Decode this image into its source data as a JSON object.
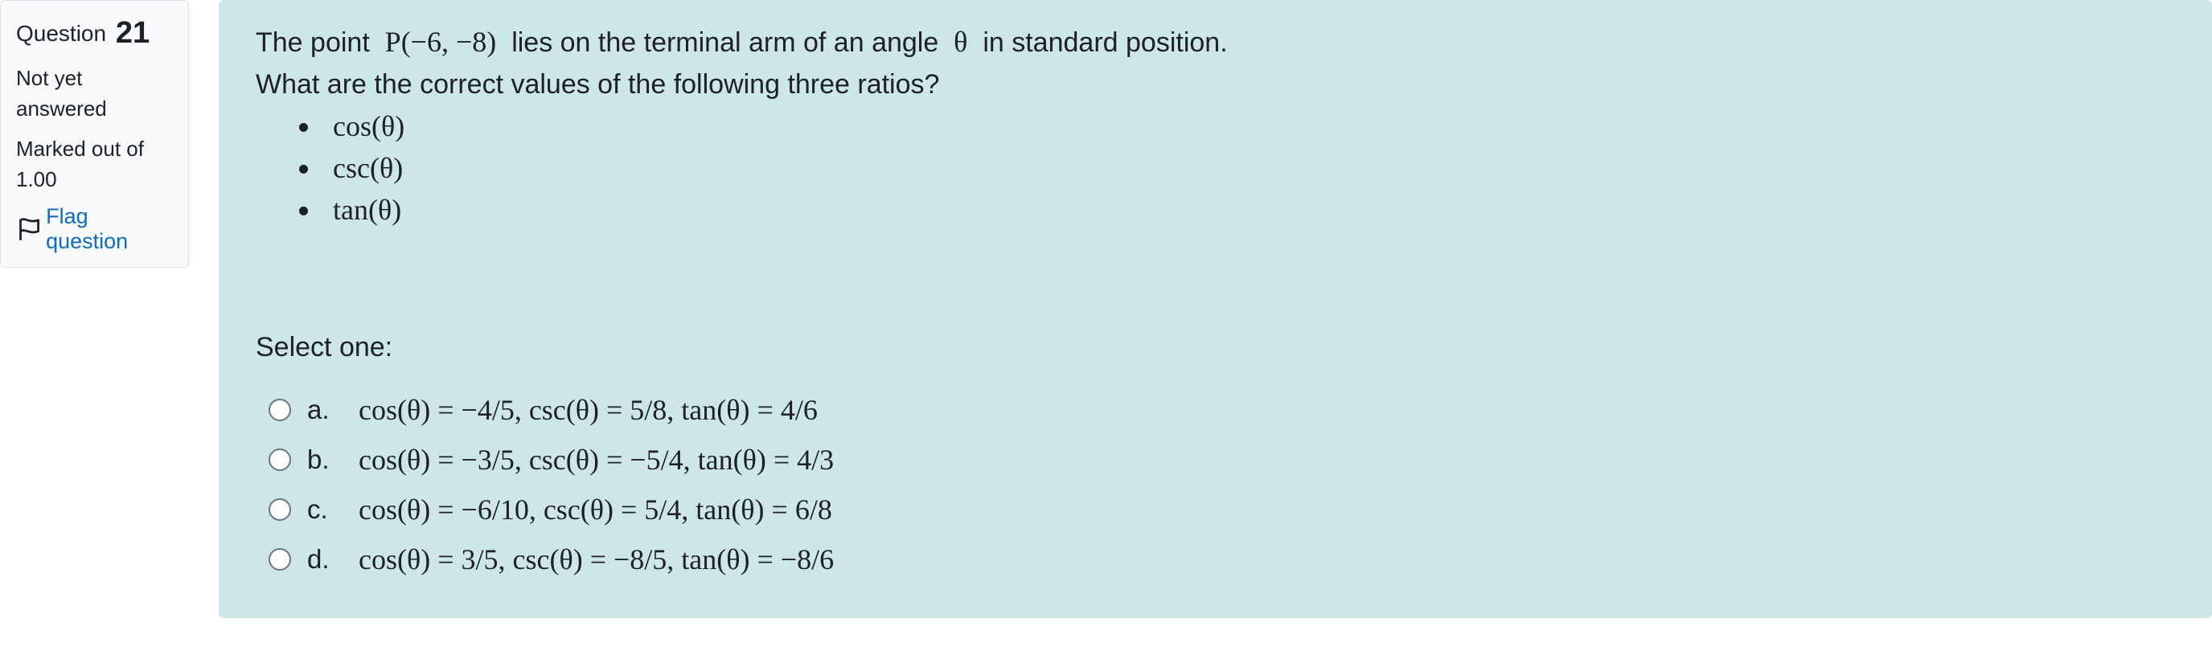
{
  "info": {
    "question_label": "Question",
    "question_number": "21",
    "status": "Not yet answered",
    "marked_out_of": "Marked out of 1.00",
    "flag_label": "Flag question"
  },
  "question": {
    "stem_pre": "The point",
    "point": "P(−6, −8)",
    "stem_mid": "lies on the terminal arm of an angle",
    "angle": "θ",
    "stem_post": "in standard position.",
    "line2": "What are the correct values of the following three ratios?",
    "ratios": [
      "cos(θ)",
      "csc(θ)",
      "tan(θ)"
    ],
    "prompt": "Select one:"
  },
  "options": [
    {
      "letter": "a.",
      "text": "cos(θ) = −4/5, csc(θ) = 5/8, tan(θ) = 4/6"
    },
    {
      "letter": "b.",
      "text": "cos(θ) = −3/5, csc(θ) = −5/4, tan(θ) = 4/3"
    },
    {
      "letter": "c.",
      "text": "cos(θ) = −6/10, csc(θ) = 5/4, tan(θ) = 6/8"
    },
    {
      "letter": "d.",
      "text": "cos(θ) = 3/5, csc(θ) = −8/5, tan(θ) = −8/6"
    }
  ],
  "icons": {
    "flag": "flag-icon",
    "radio": "radio-icon"
  }
}
